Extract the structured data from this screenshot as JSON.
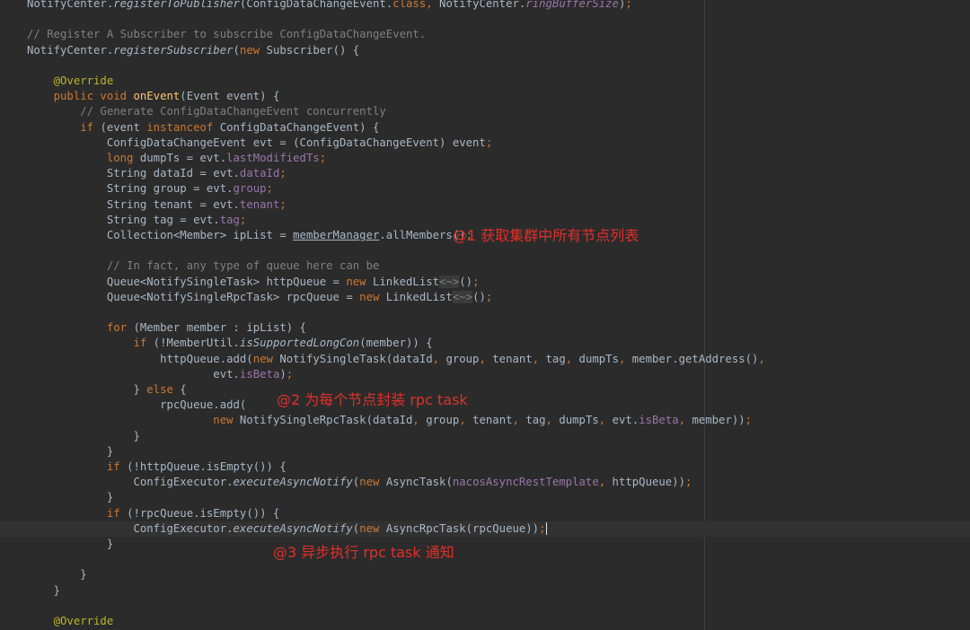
{
  "colors": {
    "background": "#2b2b2b",
    "keyword": "#cc7832",
    "annotation": "#bbb529",
    "comment": "#808080",
    "field": "#9876aa",
    "method_decl": "#ffc66d",
    "text": "#a9b7c6",
    "note_red": "#e0302a"
  },
  "code_lines": [
    [
      [
        "txt",
        "NotifyCenter."
      ],
      [
        "st",
        "registerToPublisher"
      ],
      [
        "txt",
        "(ConfigDataChangeEvent."
      ],
      [
        "kw",
        "class"
      ],
      [
        "kw",
        ", "
      ],
      [
        "txt",
        "NotifyCenter."
      ],
      [
        "fldi",
        "ringBufferSize"
      ],
      [
        "txt",
        ")"
      ],
      [
        "kw",
        ";"
      ]
    ],
    [],
    [
      [
        "cmt",
        "// Register A Subscriber to subscribe ConfigDataChangeEvent."
      ]
    ],
    [
      [
        "txt",
        "NotifyCenter."
      ],
      [
        "st",
        "registerSubscriber"
      ],
      [
        "txt",
        "("
      ],
      [
        "kw",
        "new "
      ],
      [
        "txt",
        "Subscriber() {"
      ]
    ],
    [],
    [
      [
        "ann",
        "    @Override"
      ]
    ],
    [
      [
        "kw",
        "    public void "
      ],
      [
        "fn",
        "onEvent"
      ],
      [
        "txt",
        "(Event event) {"
      ]
    ],
    [
      [
        "cmt",
        "        // Generate ConfigDataChangeEvent concurrently"
      ]
    ],
    [
      [
        "kw",
        "        if "
      ],
      [
        "txt",
        "(event "
      ],
      [
        "kw",
        "instanceof "
      ],
      [
        "txt",
        "ConfigDataChangeEvent) {"
      ]
    ],
    [
      [
        "txt",
        "            ConfigDataChangeEvent evt = (ConfigDataChangeEvent) event"
      ],
      [
        "kw",
        ";"
      ]
    ],
    [
      [
        "kw",
        "            long "
      ],
      [
        "txt",
        "dumpTs = evt."
      ],
      [
        "fld",
        "lastModifiedTs"
      ],
      [
        "kw",
        ";"
      ]
    ],
    [
      [
        "txt",
        "            String dataId = evt."
      ],
      [
        "fld",
        "dataId"
      ],
      [
        "kw",
        ";"
      ]
    ],
    [
      [
        "txt",
        "            String group = evt."
      ],
      [
        "fld",
        "group"
      ],
      [
        "kw",
        ";"
      ]
    ],
    [
      [
        "txt",
        "            String tenant = evt."
      ],
      [
        "fld",
        "tenant"
      ],
      [
        "kw",
        ";"
      ]
    ],
    [
      [
        "txt",
        "            String tag = evt."
      ],
      [
        "fld",
        "tag"
      ],
      [
        "kw",
        ";"
      ]
    ],
    [
      [
        "txt",
        "            Collection<Member> ipList = "
      ],
      [
        "ul",
        "memberManager"
      ],
      [
        "txt",
        ".allMembers()"
      ],
      [
        "kw",
        ";"
      ]
    ],
    [],
    [
      [
        "cmt",
        "            // In fact, any type of queue here can be"
      ]
    ],
    [
      [
        "txt",
        "            Queue<NotifySingleTask> httpQueue = "
      ],
      [
        "kw",
        "new "
      ],
      [
        "txt",
        "LinkedList"
      ],
      [
        "dia",
        "<~>"
      ],
      [
        "txt",
        "()"
      ],
      [
        "kw",
        ";"
      ]
    ],
    [
      [
        "txt",
        "            Queue<NotifySingleRpcTask> rpcQueue = "
      ],
      [
        "kw",
        "new "
      ],
      [
        "txt",
        "LinkedList"
      ],
      [
        "dia",
        "<~>"
      ],
      [
        "txt",
        "()"
      ],
      [
        "kw",
        ";"
      ]
    ],
    [],
    [
      [
        "kw",
        "            for "
      ],
      [
        "txt",
        "(Member member : ipList) {"
      ]
    ],
    [
      [
        "kw",
        "                if "
      ],
      [
        "txt",
        "(!MemberUtil."
      ],
      [
        "st",
        "isSupportedLongCon"
      ],
      [
        "txt",
        "(member)) {"
      ]
    ],
    [
      [
        "txt",
        "                    httpQueue.add("
      ],
      [
        "kw",
        "new "
      ],
      [
        "txt",
        "NotifySingleTask(dataId"
      ],
      [
        "kw",
        ", "
      ],
      [
        "txt",
        "group"
      ],
      [
        "kw",
        ", "
      ],
      [
        "txt",
        "tenant"
      ],
      [
        "kw",
        ", "
      ],
      [
        "txt",
        "tag"
      ],
      [
        "kw",
        ", "
      ],
      [
        "txt",
        "dumpTs"
      ],
      [
        "kw",
        ", "
      ],
      [
        "txt",
        "member.getAddress()"
      ],
      [
        "kw",
        ","
      ]
    ],
    [
      [
        "txt",
        "                            evt."
      ],
      [
        "fld",
        "isBeta"
      ],
      [
        "txt",
        ")"
      ],
      [
        "kw",
        ";"
      ]
    ],
    [
      [
        "txt",
        "                } "
      ],
      [
        "kw",
        "else "
      ],
      [
        "txt",
        "{"
      ]
    ],
    [
      [
        "txt",
        "                    rpcQueue.add("
      ]
    ],
    [
      [
        "kw",
        "                            new "
      ],
      [
        "txt",
        "NotifySingleRpcTask(dataId"
      ],
      [
        "kw",
        ", "
      ],
      [
        "txt",
        "group"
      ],
      [
        "kw",
        ", "
      ],
      [
        "txt",
        "tenant"
      ],
      [
        "kw",
        ", "
      ],
      [
        "txt",
        "tag"
      ],
      [
        "kw",
        ", "
      ],
      [
        "txt",
        "dumpTs"
      ],
      [
        "kw",
        ", "
      ],
      [
        "txt",
        "evt."
      ],
      [
        "fld",
        "isBeta"
      ],
      [
        "kw",
        ", "
      ],
      [
        "txt",
        "member))"
      ],
      [
        "kw",
        ";"
      ]
    ],
    [
      [
        "txt",
        "                }"
      ]
    ],
    [
      [
        "txt",
        "            }"
      ]
    ],
    [
      [
        "kw",
        "            if "
      ],
      [
        "txt",
        "(!httpQueue.isEmpty()) {"
      ]
    ],
    [
      [
        "txt",
        "                ConfigExecutor."
      ],
      [
        "st",
        "executeAsyncNotify"
      ],
      [
        "txt",
        "("
      ],
      [
        "kw",
        "new "
      ],
      [
        "txt",
        "AsyncTask("
      ],
      [
        "fld",
        "nacosAsyncRestTemplate"
      ],
      [
        "kw",
        ", "
      ],
      [
        "txt",
        "httpQueue))"
      ],
      [
        "kw",
        ";"
      ]
    ],
    [
      [
        "txt",
        "            }"
      ]
    ],
    [
      [
        "kw",
        "            if "
      ],
      [
        "txt",
        "(!rpcQueue.isEmpty()) {"
      ]
    ],
    [
      [
        "txt",
        "                ConfigExecutor."
      ],
      [
        "st",
        "executeAsyncNotify"
      ],
      [
        "txt",
        "("
      ],
      [
        "kw",
        "new "
      ],
      [
        "txt",
        "AsyncRpcTask(rpcQueue))"
      ],
      [
        "kw",
        ";"
      ],
      [
        "caret",
        ""
      ]
    ],
    [
      [
        "txt",
        "            }"
      ]
    ],
    [],
    [
      [
        "txt",
        "        }"
      ]
    ],
    [
      [
        "txt",
        "    }"
      ]
    ],
    [],
    [
      [
        "ann",
        "    @Override"
      ]
    ]
  ],
  "annotations": {
    "note1": "@1 获取集群中所有节点列表",
    "note2": "@2 为每个节点封装 rpc task",
    "note3": "@3 异步执行 rpc task 通知"
  }
}
